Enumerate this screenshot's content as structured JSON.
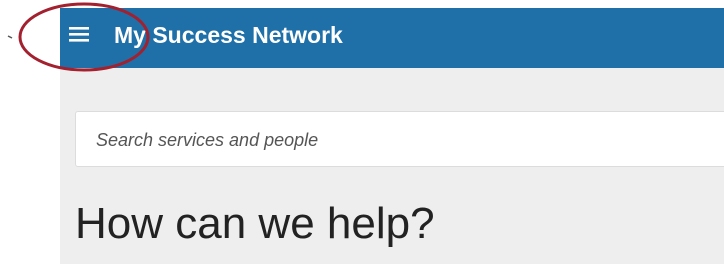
{
  "app_bar": {
    "title": "My Success Network",
    "background_color": "#1f6fa8",
    "menu_icon": "hamburger-menu-icon"
  },
  "search": {
    "placeholder": "Search services and people",
    "value": ""
  },
  "main": {
    "heading": "How can we help?"
  },
  "annotation": {
    "shape": "ellipse",
    "color": "#a3202f",
    "target": "hamburger-menu-icon"
  }
}
